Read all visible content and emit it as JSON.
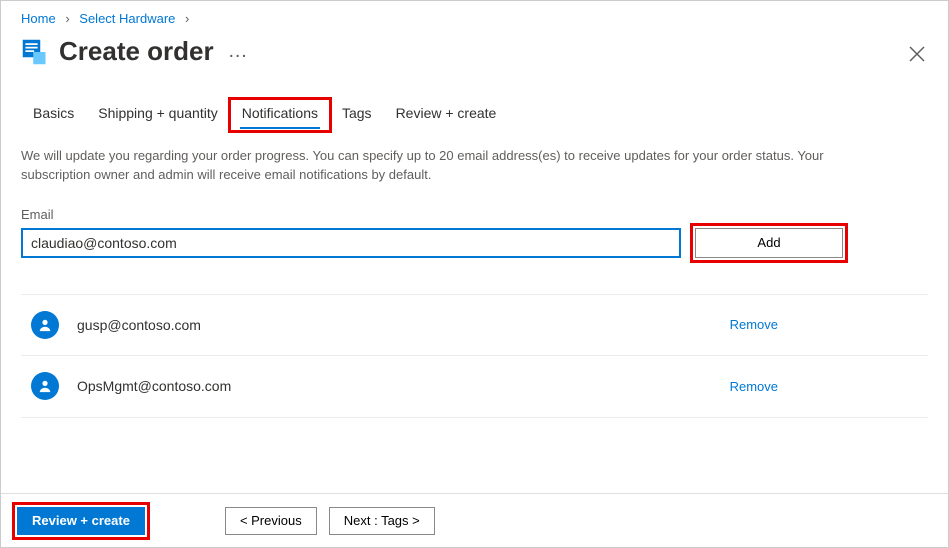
{
  "breadcrumb": {
    "home": "Home",
    "second": "Select Hardware"
  },
  "page": {
    "title": "Create order",
    "more": "…"
  },
  "tabs": {
    "basics": "Basics",
    "shipping": "Shipping + quantity",
    "notifications": "Notifications",
    "tags": "Tags",
    "review": "Review + create"
  },
  "description": "We will update you regarding your order progress. You can specify up to 20 email address(es) to receive updates for your order status. Your subscription owner and admin will receive email notifications by default.",
  "email_field": {
    "label": "Email",
    "value": "claudiao@contoso.com",
    "add_label": "Add"
  },
  "emails": {
    "item0": {
      "address": "gusp@contoso.com",
      "action": "Remove"
    },
    "item1": {
      "address": "OpsMgmt@contoso.com",
      "action": "Remove"
    }
  },
  "footer": {
    "review": "Review + create",
    "previous": "< Previous",
    "next": "Next : Tags >"
  }
}
